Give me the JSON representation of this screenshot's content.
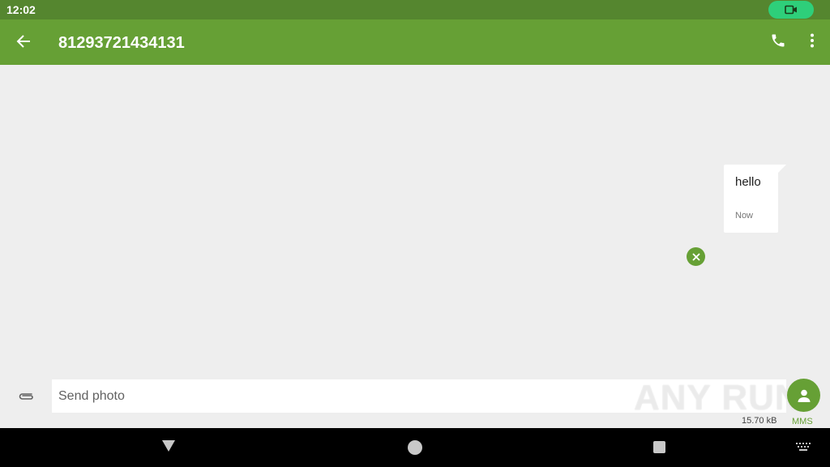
{
  "status_bar": {
    "time": "12:02",
    "record_icon": "video-camera-icon",
    "record_color": "#2ecf7a"
  },
  "app_bar": {
    "title": "81293721434131",
    "back_icon": "arrow-back-icon",
    "call_icon": "phone-icon",
    "more_icon": "more-vert-icon",
    "color": "#66a035"
  },
  "messages": [
    {
      "text": "hello",
      "time": "Now",
      "status_icon": "close-circle-icon"
    }
  ],
  "compose": {
    "attach_icon": "paperclip-icon",
    "placeholder": "Send photo",
    "attachment_size": "15.70 kB",
    "send_icon": "person-icon",
    "send_mode": "MMS"
  },
  "watermark": {
    "text": "ANY RUN"
  },
  "nav_bar": {
    "back_icon": "nav-back-triangle-icon",
    "home_icon": "nav-home-circle-icon",
    "recents_icon": "nav-recents-square-icon",
    "keyboard_icon": "keyboard-icon"
  }
}
